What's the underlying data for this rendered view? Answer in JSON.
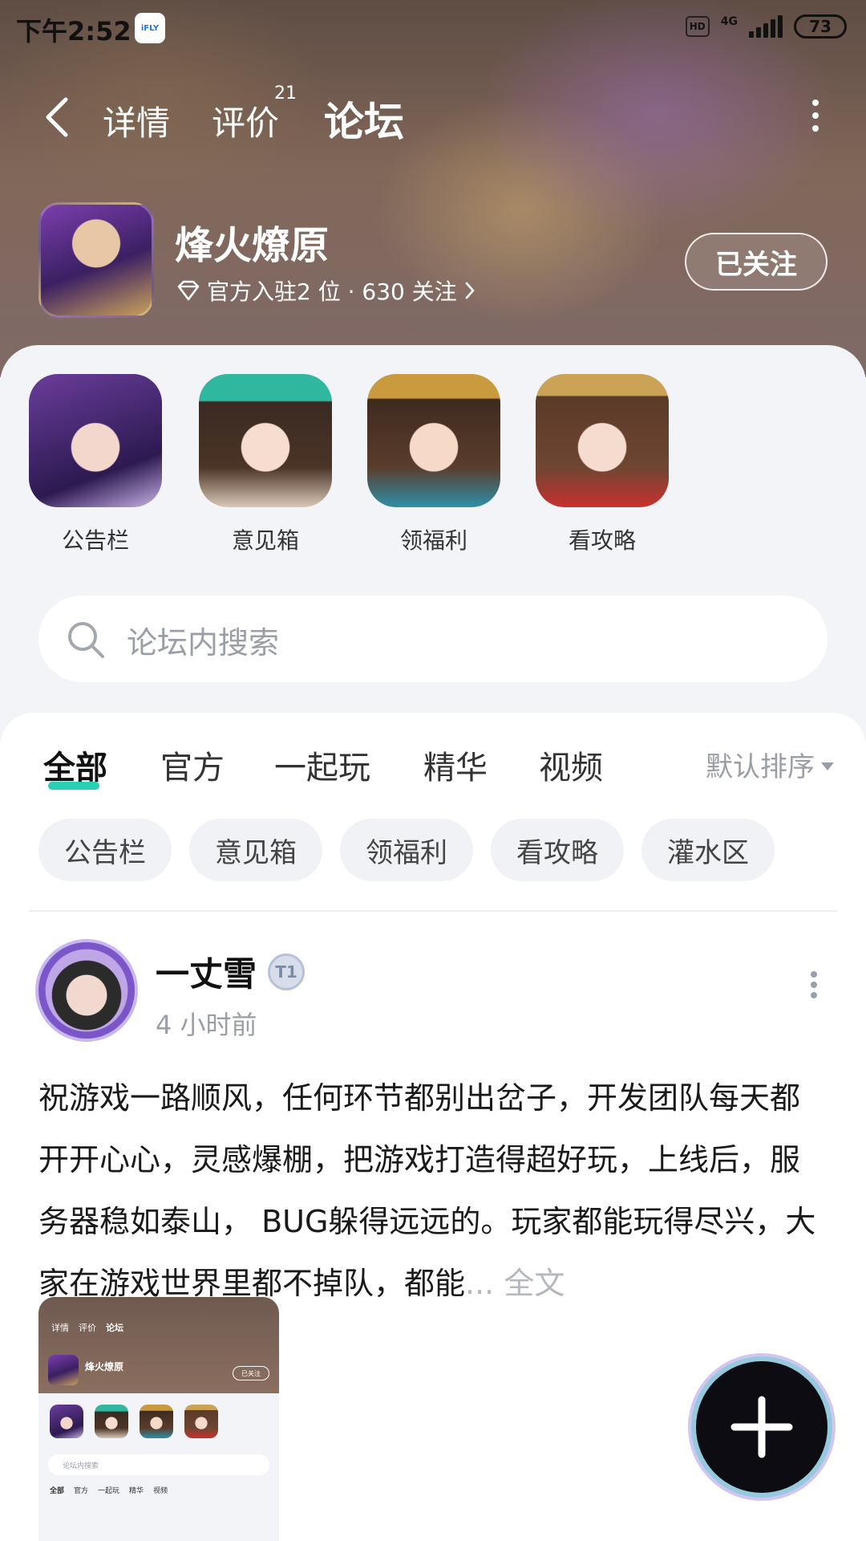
{
  "status_bar": {
    "time": "下午2:52",
    "ifly_label": "iFLY",
    "hd_label": "HD",
    "network_label": "4G",
    "battery": "73"
  },
  "nav": {
    "tabs": {
      "detail": "详情",
      "review": "评价",
      "review_badge": "21",
      "forum": "论坛"
    }
  },
  "forum": {
    "name": "烽火燎原",
    "meta": "官方入驻2 位 · 630 关注",
    "follow_label": "已关注"
  },
  "categories": [
    {
      "label": "公告栏"
    },
    {
      "label": "意见箱"
    },
    {
      "label": "领福利"
    },
    {
      "label": "看攻略"
    }
  ],
  "search": {
    "placeholder": "论坛内搜索"
  },
  "filters": {
    "tabs": {
      "all": "全部",
      "official": "官方",
      "play": "一起玩",
      "essence": "精华",
      "video": "视频"
    },
    "sort_label": "默认排序",
    "chips": [
      "公告栏",
      "意见箱",
      "领福利",
      "看攻略",
      "灌水区"
    ]
  },
  "post": {
    "username": "一丈雪",
    "level_badge": "T1",
    "time": "4 小时前",
    "body": "祝游戏一路顺风，任何环节都别出岔子，开发团队每天都开开心心，灵感爆棚，把游戏打造得超好玩，上线后，服务器稳如泰山， BUG躲得远远的。玩家都能玩得尽兴，大家在游戏世界里都不掉队，都能",
    "more_label": "... 全文",
    "thumbnail": {
      "tabs": [
        "详情",
        "评价",
        "论坛"
      ],
      "name": "烽火燎原",
      "follow": "已关注",
      "search": "论坛内搜索",
      "filters": [
        "全部",
        "官方",
        "一起玩",
        "精华",
        "视频"
      ]
    }
  },
  "colors": {
    "accent": "#28d1b2",
    "text": "#1a1a1a",
    "muted": "#9a9ea7"
  }
}
